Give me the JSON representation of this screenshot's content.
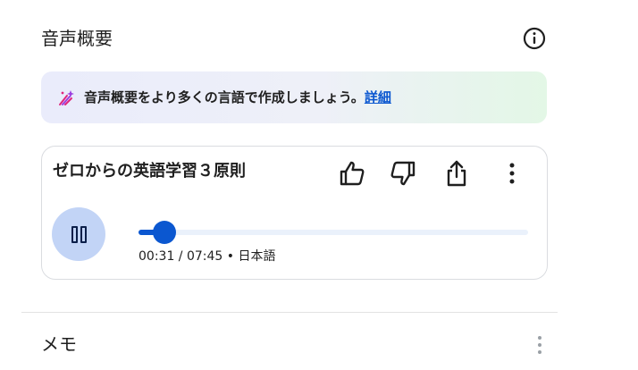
{
  "header": {
    "title": "音声概要"
  },
  "banner": {
    "text": "音声概要をより多くの言語で作成しましょう。",
    "link_label": "詳細"
  },
  "audio_card": {
    "title": "ゼロからの英語学習３原則",
    "progress": 0.0667,
    "time_current": "00:31",
    "time_separator": " / ",
    "time_total": "07:45",
    "language_separator": " • ",
    "language": "日本語"
  },
  "memo": {
    "title": "メモ"
  },
  "icons": [
    "info-icon",
    "sparkle-icon",
    "thumbs-up-icon",
    "thumbs-down-icon",
    "share-icon",
    "more-vert-icon",
    "pause-icon"
  ],
  "colors": {
    "accent": "#0b57d0",
    "play_button_bg": "#c2d4f6",
    "link": "#0b57d0"
  }
}
